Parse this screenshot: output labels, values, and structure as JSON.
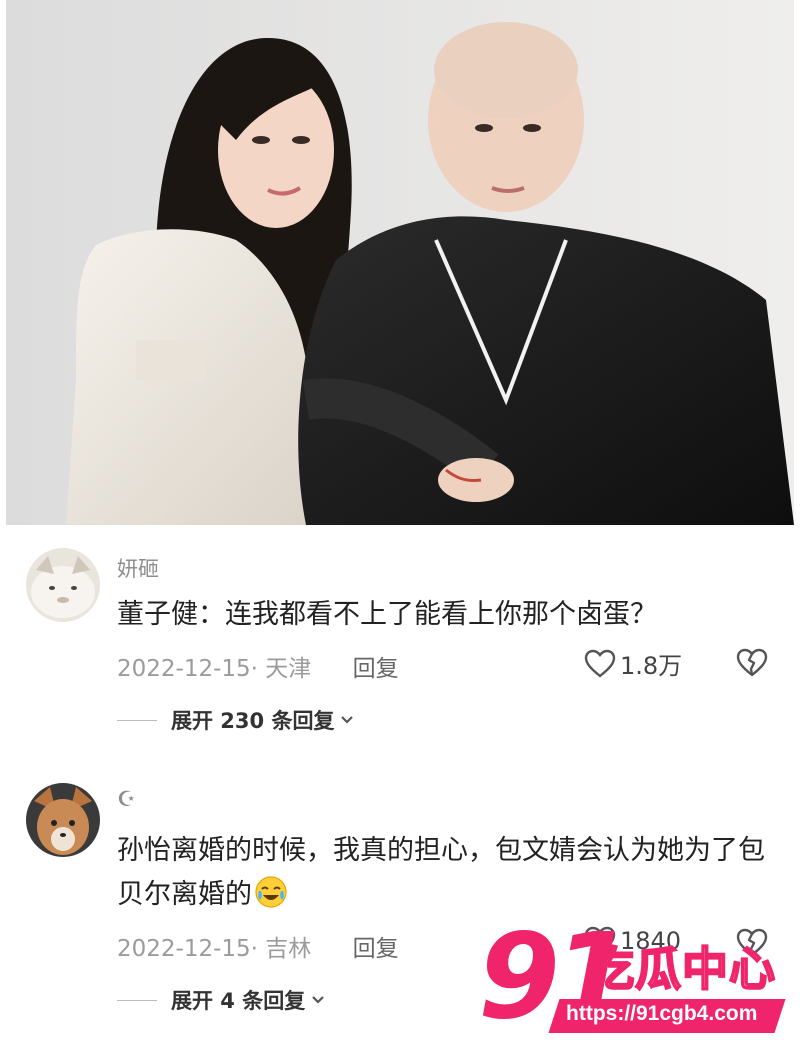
{
  "comments": [
    {
      "username": "妍砸",
      "text": "董子健：连我都看不上了能看上你那个卤蛋？",
      "date": "2022-12-15",
      "location": "· 天津",
      "reply_label": "回复",
      "likes": "1.8万",
      "expand_label": "展开 230 条回复"
    },
    {
      "username": "☪",
      "text": "孙怡离婚的时候，我真的担心，包文婧会认为她为了包贝尔离婚的",
      "date": "2022-12-15",
      "location": "· 吉林",
      "reply_label": "回复",
      "likes": "1840",
      "expand_label": "展开 4 条回复"
    }
  ],
  "watermark": {
    "number": "91",
    "title": "吃瓜中心",
    "url": "https://91cgb4.com"
  },
  "icons": {
    "like": "heart-outline-icon",
    "dislike": "broken-heart-icon",
    "expand": "chevron-down-icon",
    "emoji": "crying-laugh-emoji"
  },
  "colors": {
    "watermark_pink": "#f0246a",
    "meta_gray": "#9b9b9b"
  }
}
